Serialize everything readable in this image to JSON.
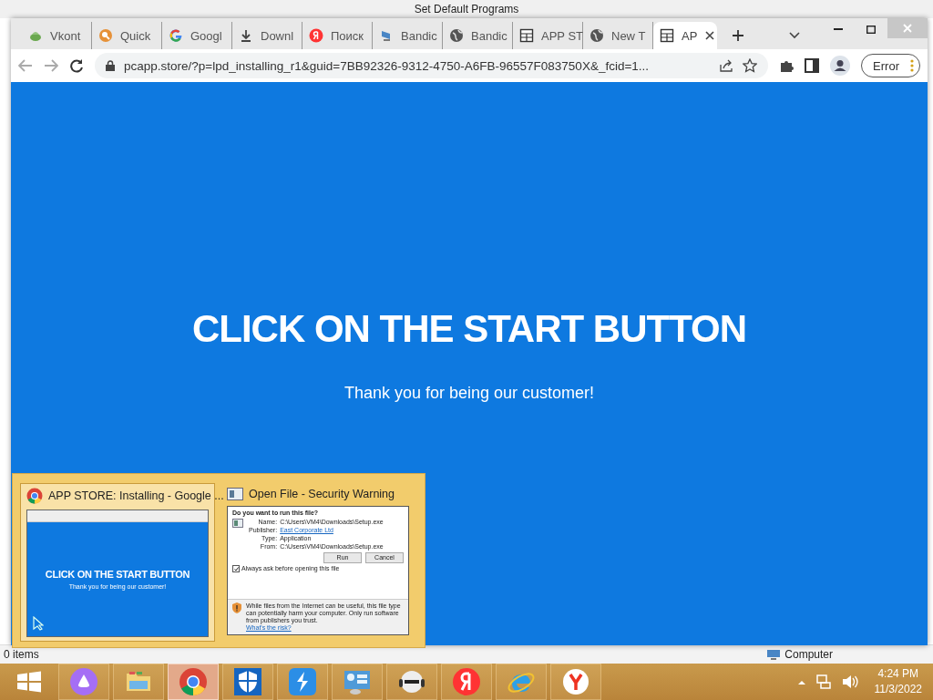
{
  "background_window": {
    "title": "Set Default Programs",
    "status_text": "0 items",
    "item": "Computer"
  },
  "browser": {
    "tabs": [
      {
        "label": "Vkont",
        "kind": "leaf",
        "selected": false
      },
      {
        "label": "Quick",
        "kind": "search",
        "selected": false
      },
      {
        "label": "Googl",
        "kind": "google",
        "selected": false
      },
      {
        "label": "Downl",
        "kind": "download",
        "selected": false
      },
      {
        "label": "Поиск",
        "kind": "yandex",
        "selected": false
      },
      {
        "label": "Bandic",
        "kind": "bandicam",
        "selected": false
      },
      {
        "label": "Bandic",
        "kind": "globe",
        "selected": false
      },
      {
        "label": "APP ST",
        "kind": "table",
        "selected": false
      },
      {
        "label": "New T",
        "kind": "globe",
        "selected": false
      },
      {
        "label": "AP",
        "kind": "table",
        "selected": true
      }
    ],
    "url": "pcapp.store/?p=lpd_installing_r1&guid=7BB92326-9312-4750-A6FB-96557F083750X&_fcid=1...",
    "profile_label": "Error"
  },
  "page": {
    "headline": "CLICK ON THE START BUTTON",
    "subtitle": "Thank you for being our customer!"
  },
  "task_previews": [
    {
      "title": "APP STORE: Installing - Google ...",
      "kind": "browser",
      "selected": true,
      "headline": "CLICK ON THE START BUTTON",
      "subtitle": "Thank you for being our customer!"
    },
    {
      "title": "Open File - Security Warning",
      "kind": "dialog",
      "selected": false,
      "question": "Do you want to run this file?",
      "fields": [
        {
          "label": "Name:",
          "value": "C:\\Users\\VM4\\Downloads\\Setup.exe",
          "kind": "text"
        },
        {
          "label": "Publisher:",
          "value": "East Corporate Ltd",
          "kind": "link"
        },
        {
          "label": "Type:",
          "value": "Application",
          "kind": "text"
        },
        {
          "label": "From:",
          "value": "C:\\Users\\VM4\\Downloads\\Setup.exe",
          "kind": "text"
        }
      ],
      "buttons": [
        "Run",
        "Cancel"
      ],
      "checkbox": {
        "label": "Always ask before opening this file",
        "checked": true
      },
      "warning": "While files from the Internet can be useful, this file type can potentially harm your computer. Only run software from publishers you trust.",
      "risk_link": "What's the risk?"
    }
  ],
  "taskbar": {
    "apps": [
      {
        "kind": "start",
        "selected": false
      },
      {
        "kind": "alice",
        "selected": false
      },
      {
        "kind": "explorer",
        "selected": false
      },
      {
        "kind": "chrome",
        "selected": true
      },
      {
        "kind": "shield",
        "selected": false
      },
      {
        "kind": "bolt",
        "selected": false
      },
      {
        "kind": "panel",
        "selected": false
      },
      {
        "kind": "robot",
        "selected": false
      },
      {
        "kind": "yandex",
        "selected": false
      },
      {
        "kind": "ie",
        "selected": false
      },
      {
        "kind": "ybrowser",
        "selected": false
      }
    ],
    "time": "4:24 PM",
    "date": "11/3/2022"
  }
}
